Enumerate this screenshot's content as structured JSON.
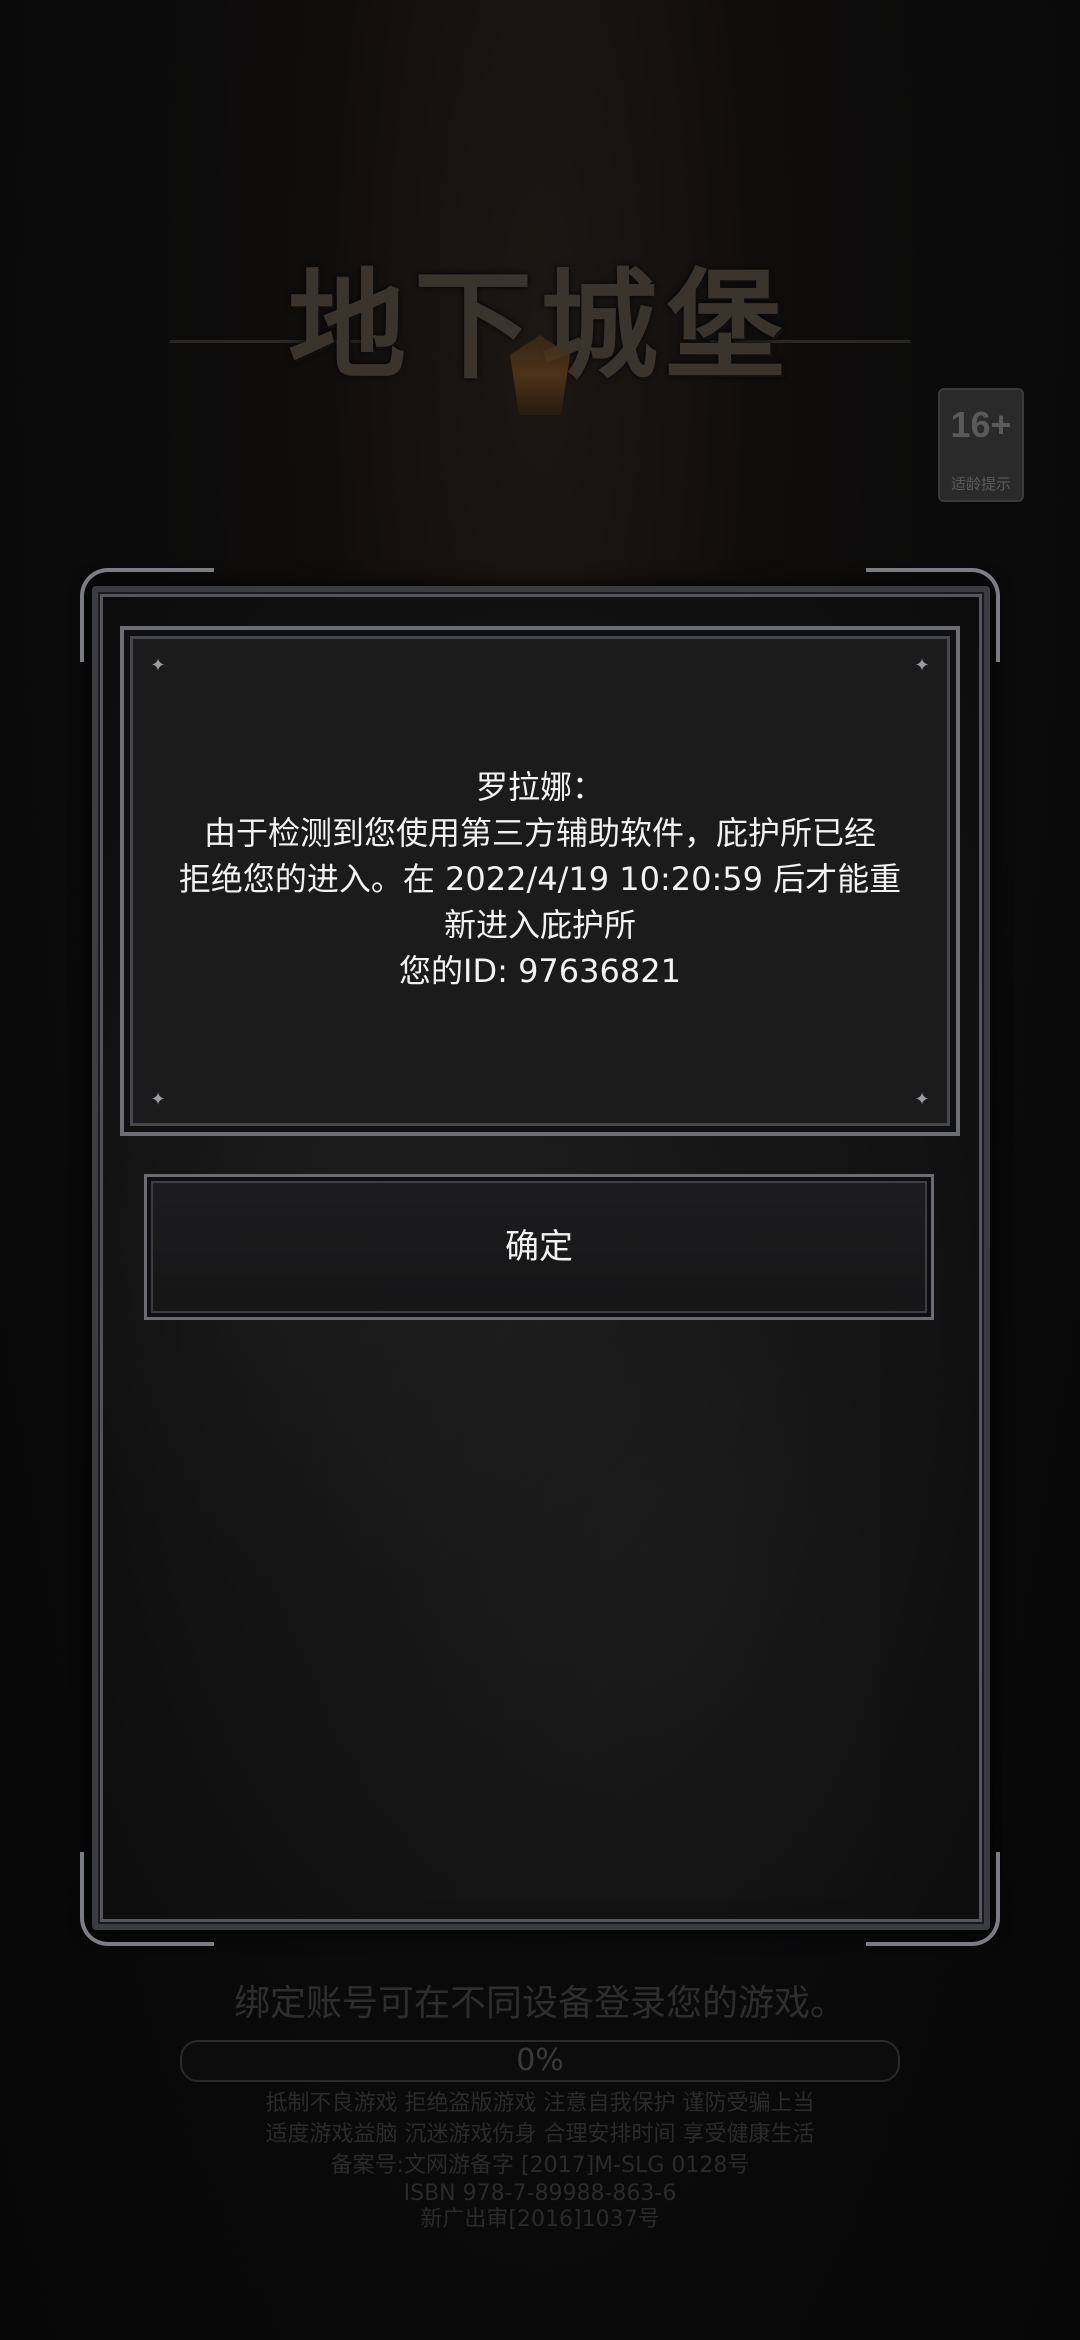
{
  "background": {
    "logo_text": "地下城堡"
  },
  "age_badge": {
    "rating": "16+",
    "label": "适龄提示"
  },
  "dialog": {
    "speaker": "罗拉娜：",
    "message_line1": "由于检测到您使用第三方辅助软件，庇护所已经",
    "message_line2": "拒绝您的进入。在 2022/4/19 10:20:59 后才能重",
    "message_line3": "新进入庇护所",
    "id_line": "您的ID: 97636821",
    "confirm_label": "确定"
  },
  "footer": {
    "bind_tip": "绑定账号可在不同设备登录您的游戏。",
    "progress_percent": 0,
    "progress_text": "0%",
    "health_notice_1": "抵制不良游戏  拒绝盗版游戏  注意自我保护  谨防受骗上当",
    "health_notice_2": "适度游戏益脑  沉迷游戏伤身  合理安排时间  享受健康生活",
    "record_no": "备案号:文网游备字 [2017]M-SLG 0128号",
    "isbn": "ISBN 978-7-89988-863-6",
    "approval": "新广出审[2016]1037号"
  }
}
